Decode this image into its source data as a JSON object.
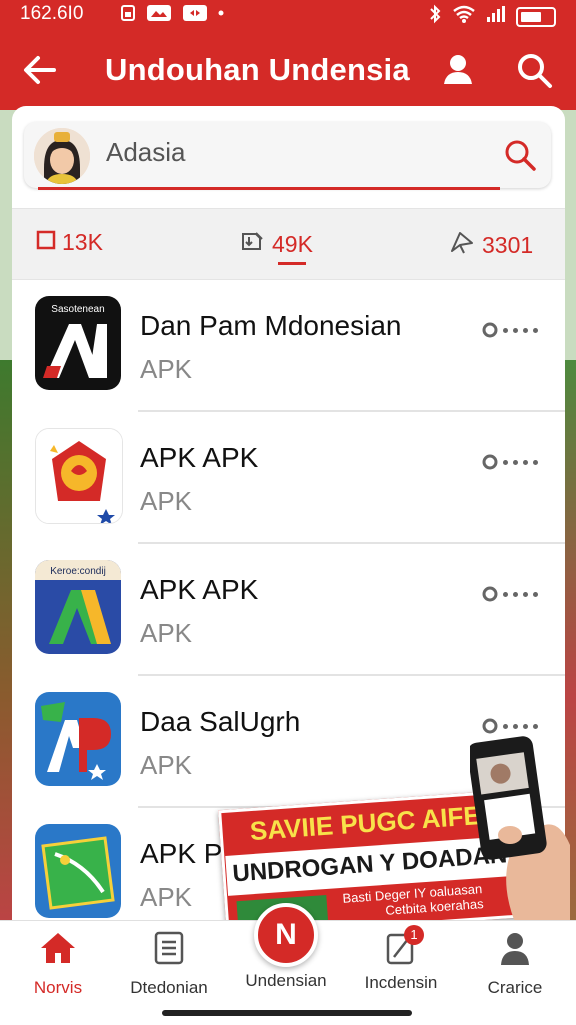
{
  "status_bar": {
    "time": "162.6I0",
    "icons": [
      "sim-icon",
      "photo-icon",
      "nav-icon"
    ],
    "right_icons": [
      "bluetooth-icon",
      "wifi-icon",
      "signal-icon",
      "battery-icon"
    ]
  },
  "header": {
    "title": "Undouhan Undensia",
    "back_icon": "arrow-left-icon",
    "user_icon": "user-icon",
    "search_icon": "search-icon"
  },
  "search": {
    "placeholder": "Adasia",
    "value": ""
  },
  "stats": [
    {
      "icon": "square-icon",
      "value": "13K"
    },
    {
      "icon": "download-icon",
      "value": "49K"
    },
    {
      "icon": "share-icon",
      "value": "3301"
    }
  ],
  "apps": [
    {
      "name": "Dan Pam Mdonesian",
      "sub": "APK",
      "icon_text": "Sasotenean",
      "icon_bg": "#111111",
      "icon_letter": "A"
    },
    {
      "name": "APK APK",
      "sub": "APK",
      "icon_text": "",
      "icon_bg": "#ffffff",
      "icon_letter": ""
    },
    {
      "name": "APK APK",
      "sub": "APK",
      "icon_text": "Keroe:condij",
      "icon_bg": "#2a4ba6",
      "icon_letter": "A"
    },
    {
      "name": "Daa SalUgrh",
      "sub": "APK",
      "icon_text": "",
      "icon_bg": "#2a78c8",
      "icon_letter": "P"
    },
    {
      "name": "APK P",
      "sub": "APK",
      "icon_text": "",
      "icon_bg": "#2a78c8",
      "icon_letter": ""
    }
  ],
  "promo": {
    "title": "SAVIIE PUGC AIFE",
    "subtitle": "UNDROGAN Y DOADAN",
    "line1": "Basti Deger IY oaluasan",
    "line2": "Cetbita koerahas"
  },
  "bottom_nav": [
    {
      "label": "Norvis",
      "icon": "home-icon",
      "active": true
    },
    {
      "label": "Dtedonian",
      "icon": "document-icon",
      "active": false
    },
    {
      "label": "Undensian",
      "icon": "n-logo-icon",
      "active": false,
      "center_letter": "N"
    },
    {
      "label": "Incdensin",
      "icon": "edit-icon",
      "active": false,
      "badge": "1"
    },
    {
      "label": "Crarice",
      "icon": "person-icon",
      "active": false
    }
  ],
  "colors": {
    "primary": "#d42a27",
    "text": "#111111",
    "muted": "#888888",
    "accent_yellow": "#f8e24a"
  }
}
